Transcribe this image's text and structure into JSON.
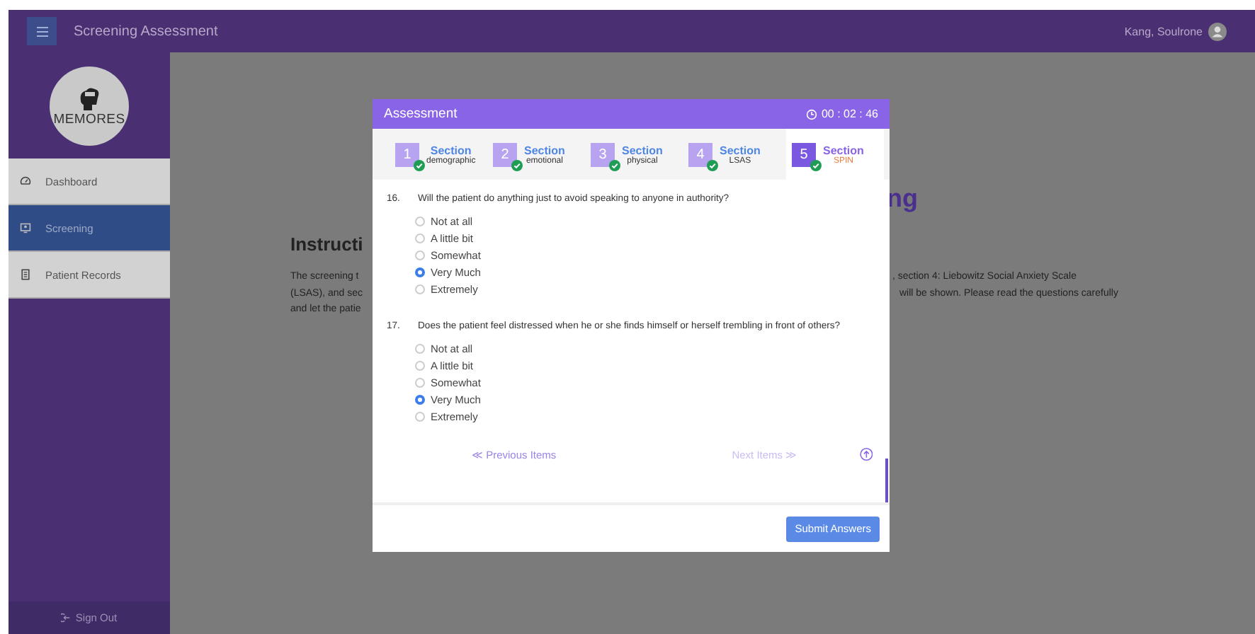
{
  "top_bar": {
    "title": "Screening Assessment",
    "user_name": "Kang, Soulrone"
  },
  "sidebar": {
    "logo_text": "MEMORES",
    "items": [
      {
        "label": "Dashboard",
        "selected": false
      },
      {
        "label": "Screening",
        "selected": true
      },
      {
        "label": "Patient Records",
        "selected": false
      }
    ],
    "sign_out": "Sign Out"
  },
  "background": {
    "heading_end": "ng",
    "instructions_title": "Instructi",
    "text_left": [
      "The screening t",
      "(LSAS), and sec",
      "and let the patie"
    ],
    "text_right": [
      ", section 4: Liebowitz Social Anxiety Scale",
      "will be shown. Please read the questions carefully"
    ]
  },
  "modal": {
    "title": "Assessment",
    "timer": "00 : 02 : 46",
    "steps": [
      {
        "number": "1",
        "title": "Section",
        "subtitle": "demographic",
        "completed": true,
        "selected": false
      },
      {
        "number": "2",
        "title": "Section",
        "subtitle": "emotional",
        "completed": true,
        "selected": false
      },
      {
        "number": "3",
        "title": "Section",
        "subtitle": "physical",
        "completed": true,
        "selected": false
      },
      {
        "number": "4",
        "title": "Section",
        "subtitle": "LSAS",
        "completed": true,
        "selected": false
      },
      {
        "number": "5",
        "title": "Section",
        "subtitle": "SPIN",
        "completed": true,
        "selected": true
      }
    ],
    "questions": [
      {
        "number": "16.",
        "text": "Will the patient do anything just to avoid speaking to anyone in authority?",
        "options": [
          {
            "label": "Not at all",
            "selected": false
          },
          {
            "label": "A little bit",
            "selected": false
          },
          {
            "label": "Somewhat",
            "selected": false
          },
          {
            "label": "Very Much",
            "selected": true
          },
          {
            "label": "Extremely",
            "selected": false
          }
        ]
      },
      {
        "number": "17.",
        "text": "Does the patient feel distressed when he or she finds himself or herself trembling in front of others?",
        "options": [
          {
            "label": "Not at all",
            "selected": false
          },
          {
            "label": "A little bit",
            "selected": false
          },
          {
            "label": "Somewhat",
            "selected": false
          },
          {
            "label": "Very Much",
            "selected": true
          },
          {
            "label": "Extremely",
            "selected": false
          }
        ]
      }
    ],
    "previous": {
      "label": "≪ Previous Items",
      "disabled": false
    },
    "next": {
      "label": "Next Items ≫",
      "disabled": true
    },
    "submit": "Submit Answers"
  }
}
